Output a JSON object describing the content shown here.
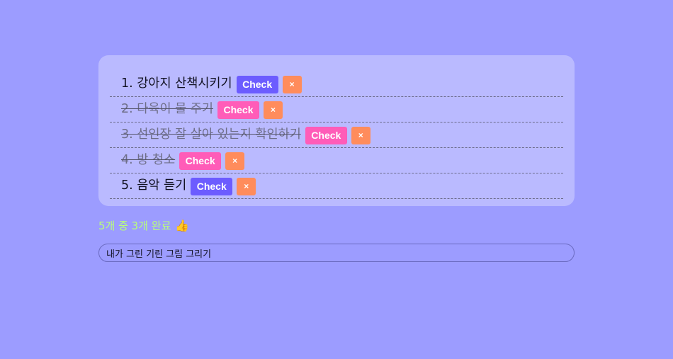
{
  "todos": [
    {
      "text": "1. 강아지 산책시키기",
      "done": false,
      "check_label": "Check",
      "delete_label": "×"
    },
    {
      "text": "2. 다육이 물 주기",
      "done": true,
      "check_label": "Check",
      "delete_label": "×"
    },
    {
      "text": "3. 선인장 잘 살아 있는지 확인하기",
      "done": true,
      "check_label": "Check",
      "delete_label": "×"
    },
    {
      "text": "4. 방 청소",
      "done": true,
      "check_label": "Check",
      "delete_label": "×"
    },
    {
      "text": "5. 음악 듣기",
      "done": false,
      "check_label": "Check",
      "delete_label": "×"
    }
  ],
  "status": {
    "text": "5개 중 3개 완료",
    "emoji": "👍",
    "icon": "thumbs-up-icon"
  },
  "input": {
    "value": "내가 그린 기린 그림 그리기"
  },
  "colors": {
    "background": "#9c9cff",
    "card": "#babaff",
    "check_active": "#6c5cff",
    "check_done": "#ff5cb8",
    "delete": "#ff8c5c",
    "status_text": "#b8ff7a"
  }
}
